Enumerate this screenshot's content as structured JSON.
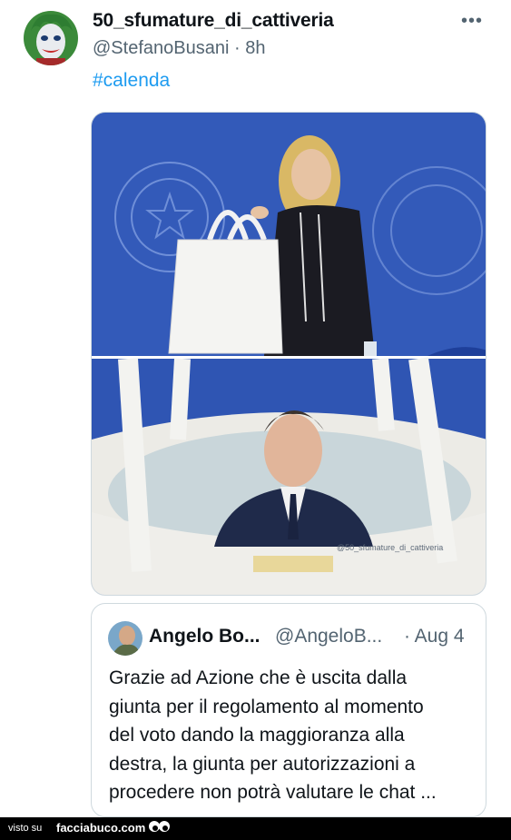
{
  "tweet": {
    "display_name": "50_sfumature_di_cattiveria",
    "handle": "@StefanoBusani",
    "separator": "·",
    "time": "8h",
    "more_label": "•••",
    "hashtag": "#calenda",
    "media": {
      "watermark": "@50_sfumature_di_cattiveria"
    }
  },
  "quoted": {
    "name": "Angelo Bo...",
    "handle": "@AngeloB...",
    "date": "· Aug 4",
    "text": "Grazie ad Azione che è uscita dalla\ngiunta per il regolamento al momento\ndel voto  dando la maggioranza alla\ndestra, la giunta per autorizzazioni a\nprocedere non potrà valutare le chat ..."
  },
  "footer": {
    "visto_label": "visto su",
    "site": "facciabuco.com"
  },
  "colors": {
    "link": "#1d9bf0",
    "secondary_text": "#536471",
    "backdrop_blue": "#2f55b3"
  }
}
